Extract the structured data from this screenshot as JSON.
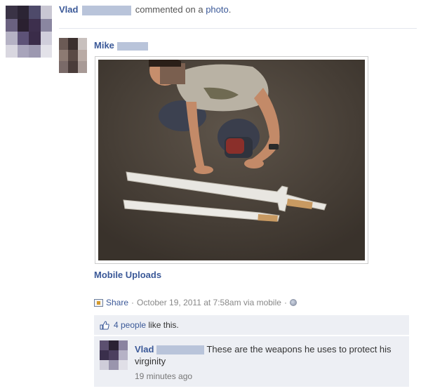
{
  "story": {
    "actor_name": "Vlad",
    "verb": "commented on a",
    "object_link": "photo",
    "object_suffix": "."
  },
  "post": {
    "author_name": "Mike",
    "album_link": "Mobile Uploads",
    "share_label": "Share",
    "timestamp": "October 19, 2011 at 7:58am via mobile",
    "separator": "·"
  },
  "likes": {
    "count_link": "4 people",
    "suffix": "like this."
  },
  "comment": {
    "author_name": "Vlad",
    "text": "These are the weapons he uses to protect his virginity",
    "time": "19 minutes ago"
  },
  "colors": {
    "link": "#3b5998",
    "ufi_bg": "#edeff4"
  },
  "icons": [
    "share-icon",
    "globe-icon",
    "thumbs-up-icon"
  ]
}
